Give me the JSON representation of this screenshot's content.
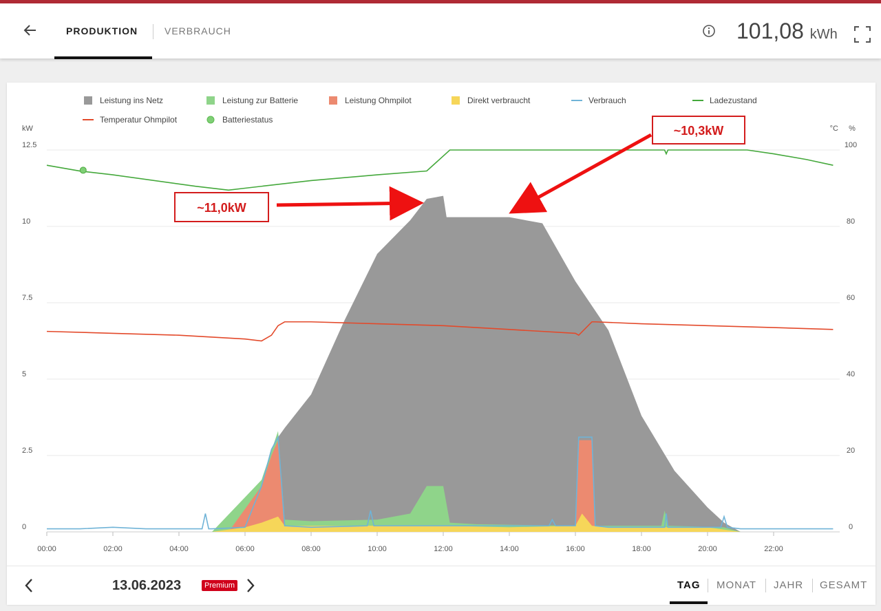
{
  "header": {
    "tabs": [
      {
        "label": "PRODUKTION",
        "active": true
      },
      {
        "label": "VERBRAUCH",
        "active": false
      }
    ],
    "energy_value": "101,08",
    "energy_unit": "kWh",
    "icons": [
      "back-arrow-icon",
      "info-icon",
      "fullscreen-icon"
    ]
  },
  "footer": {
    "date": "13.06.2023",
    "badge": "Premium",
    "periods": [
      "TAG",
      "MONAT",
      "JAHR",
      "GESAMT"
    ],
    "active_period": "TAG"
  },
  "colors": {
    "brand": "#b02a35",
    "netz": "#999999",
    "batterie": "#8fd48a",
    "ohmpilot": "#ec8a70",
    "direkt": "#f6d659",
    "verbrauch": "#6fb3d7",
    "ladezustand": "#44a83b",
    "temperatur": "#e3492a"
  },
  "chart_data": {
    "type": "area",
    "left_axis_unit": "kW",
    "right_axis_unit_1": "°C",
    "right_axis_unit_2": "%",
    "ylim_left": [
      0,
      12.5
    ],
    "ylim_right": [
      0,
      100
    ],
    "yticks_left": [
      "0",
      "2.5",
      "5",
      "7.5",
      "10",
      "12.5"
    ],
    "yticks_right": [
      "0",
      "20",
      "40",
      "60",
      "80",
      "100"
    ],
    "xticks": [
      "00:00",
      "02:00",
      "04:00",
      "06:00",
      "08:00",
      "10:00",
      "12:00",
      "14:00",
      "16:00",
      "18:00",
      "20:00",
      "22:00"
    ],
    "grid": true,
    "legend_position": "top",
    "legend": [
      {
        "name": "Leistung ins Netz",
        "marker": "square",
        "color": "#999999"
      },
      {
        "name": "Leistung zur Batterie",
        "marker": "square",
        "color": "#8fd48a"
      },
      {
        "name": "Leistung Ohmpilot",
        "marker": "square",
        "color": "#ec8a70"
      },
      {
        "name": "Direkt verbraucht",
        "marker": "square",
        "color": "#f6d659"
      },
      {
        "name": "Verbrauch",
        "marker": "line",
        "color": "#6fb3d7"
      },
      {
        "name": "Ladezustand",
        "marker": "line",
        "color": "#44a83b"
      },
      {
        "name": "Temperatur Ohmpilot",
        "marker": "line",
        "color": "#e3492a"
      },
      {
        "name": "Batteriestatus",
        "marker": "circle",
        "color": "#7fcf76"
      }
    ],
    "series": [
      {
        "name": "Leistung ins Netz",
        "axis": "left",
        "type": "area",
        "x": [
          0,
          5,
          6.5,
          7,
          7.2,
          8,
          9,
          10,
          11,
          11.5,
          12,
          12.1,
          13,
          14,
          15,
          16,
          17,
          18,
          19,
          20,
          20.5,
          21,
          24
        ],
        "y": [
          0,
          0,
          1.5,
          3.1,
          3.4,
          4.5,
          6.9,
          9.1,
          10.2,
          10.9,
          11.0,
          10.3,
          10.3,
          10.3,
          10.1,
          8.2,
          6.6,
          3.8,
          2.0,
          0.8,
          0.3,
          0,
          0
        ]
      },
      {
        "name": "Leistung zur Batterie",
        "axis": "left",
        "type": "area",
        "x": [
          0,
          5,
          6.5,
          7,
          7.2,
          8,
          10,
          11,
          11.5,
          12,
          12.2,
          13,
          16,
          18.6,
          18.7,
          18.8,
          20.5,
          21,
          24
        ],
        "y": [
          0,
          0,
          1.7,
          3.3,
          0.4,
          0.35,
          0.4,
          0.6,
          1.5,
          1.5,
          0.3,
          0.25,
          0.2,
          0.2,
          0.7,
          0.2,
          0.15,
          0,
          0
        ]
      },
      {
        "name": "Leistung Ohmpilot",
        "axis": "left",
        "type": "area",
        "x": [
          0,
          5.5,
          6.5,
          6.8,
          7,
          7.2,
          8,
          16,
          16.1,
          16.5,
          16.6,
          24
        ],
        "y": [
          0,
          0,
          1.5,
          2.5,
          3.0,
          0,
          0,
          0,
          3.0,
          3.0,
          0,
          0
        ]
      },
      {
        "name": "Direkt verbraucht",
        "axis": "left",
        "type": "area",
        "x": [
          0,
          5,
          6,
          6.5,
          7,
          7.2,
          8,
          10,
          12,
          14,
          16,
          16.2,
          16.5,
          17,
          20,
          21,
          24
        ],
        "y": [
          0,
          0,
          0.15,
          0.3,
          0.5,
          0.2,
          0.2,
          0.2,
          0.2,
          0.15,
          0.2,
          0.6,
          0.2,
          0.15,
          0.15,
          0,
          0
        ]
      },
      {
        "name": "Verbrauch",
        "axis": "left",
        "type": "line",
        "x": [
          0,
          1,
          2,
          3,
          4,
          4.7,
          4.8,
          4.9,
          5,
          6,
          6.5,
          6.8,
          7,
          7.2,
          8,
          9.7,
          9.8,
          9.9,
          10,
          11,
          12,
          13,
          14,
          15,
          15.2,
          15.3,
          15.4,
          16,
          16.1,
          16.5,
          16.6,
          17,
          18,
          18.7,
          18.75,
          18.8,
          19,
          20,
          20.4,
          20.5,
          20.6,
          21,
          22,
          23,
          23.8
        ],
        "y": [
          0.1,
          0.1,
          0.15,
          0.1,
          0.1,
          0.1,
          0.6,
          0.1,
          0.1,
          0.15,
          1.5,
          2.7,
          3.1,
          0.2,
          0.15,
          0.2,
          0.7,
          0.2,
          0.2,
          0.2,
          0.2,
          0.2,
          0.2,
          0.2,
          0.2,
          0.4,
          0.2,
          0.2,
          3.1,
          3.1,
          0.2,
          0.15,
          0.15,
          0.15,
          0.6,
          0.15,
          0.15,
          0.15,
          0.15,
          0.5,
          0.15,
          0.1,
          0.1,
          0.1,
          0.1
        ]
      },
      {
        "name": "Ladezustand",
        "axis": "right",
        "type": "line",
        "x": [
          0,
          1,
          2,
          4.5,
          5.5,
          6,
          8,
          10,
          11.5,
          12.2,
          12.8,
          13,
          18,
          18.7,
          18.75,
          18.8,
          20,
          21.2,
          22,
          23,
          23.8
        ],
        "y": [
          96,
          94.5,
          93.5,
          90.5,
          89.5,
          90,
          92,
          93.5,
          94.5,
          100,
          100,
          100,
          100,
          100,
          99,
          100,
          100,
          100,
          99,
          97.5,
          96
        ]
      },
      {
        "name": "Temperatur Ohmpilot",
        "axis": "right",
        "type": "line",
        "x": [
          0,
          2,
          4,
          5,
          6,
          6.5,
          6.8,
          7,
          7.2,
          8,
          10,
          12,
          14,
          15,
          16,
          16.1,
          16.5,
          16.6,
          18,
          20,
          22,
          23.8
        ],
        "y": [
          52.5,
          52,
          51.5,
          51,
          50.5,
          50,
          51.5,
          54,
          55,
          55,
          54.5,
          54,
          53,
          52.5,
          52,
          51.5,
          55,
          55,
          54.5,
          54,
          53.5,
          53
        ]
      },
      {
        "name": "Batteriestatus",
        "axis": "right",
        "type": "scatter",
        "x": [
          1.1
        ],
        "y": [
          94.7
        ]
      }
    ],
    "annotations": [
      {
        "text": "~11,0kW",
        "target_x": 11.5,
        "target_y": 10.9
      },
      {
        "text": "~10,3kW",
        "target_x": 14.0,
        "target_y": 10.3
      }
    ]
  }
}
